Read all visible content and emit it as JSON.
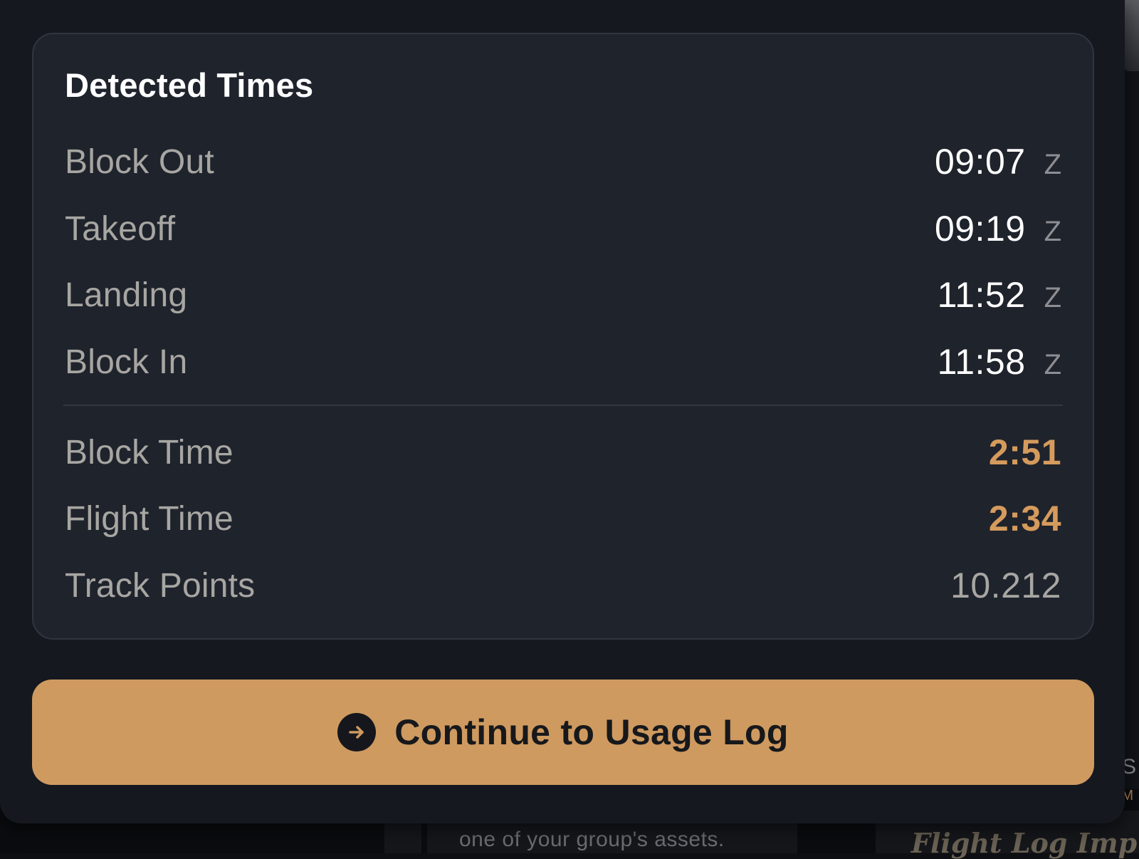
{
  "card": {
    "title": "Detected Times",
    "times": [
      {
        "label": "Block Out",
        "value": "09:07",
        "unit": "Z"
      },
      {
        "label": "Takeoff",
        "value": "09:19",
        "unit": "Z"
      },
      {
        "label": "Landing",
        "value": "11:52",
        "unit": "Z"
      },
      {
        "label": "Block In",
        "value": "11:58",
        "unit": "Z"
      }
    ],
    "summary": [
      {
        "label": "Block Time",
        "value": "2:51"
      },
      {
        "label": "Flight Time",
        "value": "2:34"
      },
      {
        "label": "Track Points",
        "value": "10.212"
      }
    ]
  },
  "cta": {
    "label": "Continue to Usage Log",
    "icon": "arrow-right-circle-icon"
  },
  "background": {
    "caption": "one of your group's assets.",
    "heading": "Flight Log Imp",
    "edge_letter": "S",
    "edge_small": "M"
  },
  "colors": {
    "sheet": "#15181f",
    "card": "#1f232c",
    "accent": "#d59b5d",
    "button": "#ce9a60"
  }
}
